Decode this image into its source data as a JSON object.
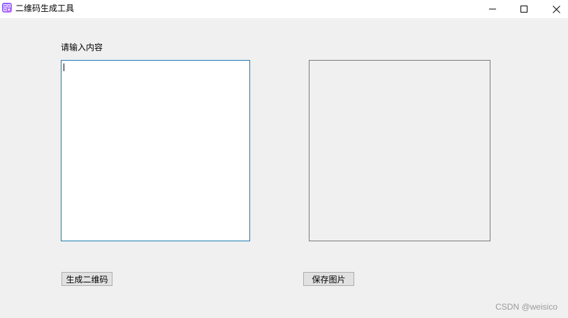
{
  "window": {
    "title": "二维码生成工具",
    "icon": "qr-app-icon",
    "controls": {
      "minimize": "minimize-icon",
      "maximize": "maximize-icon",
      "close": "close-icon"
    }
  },
  "form": {
    "input_label": "请输入内容",
    "input_value": ""
  },
  "buttons": {
    "generate": "生成二维码",
    "save": "保存图片"
  },
  "watermark": "CSDN @weisico",
  "colors": {
    "input_border": "#1a7ab5",
    "qr_border": "#7a7a7a",
    "background": "#f0f0f0"
  }
}
